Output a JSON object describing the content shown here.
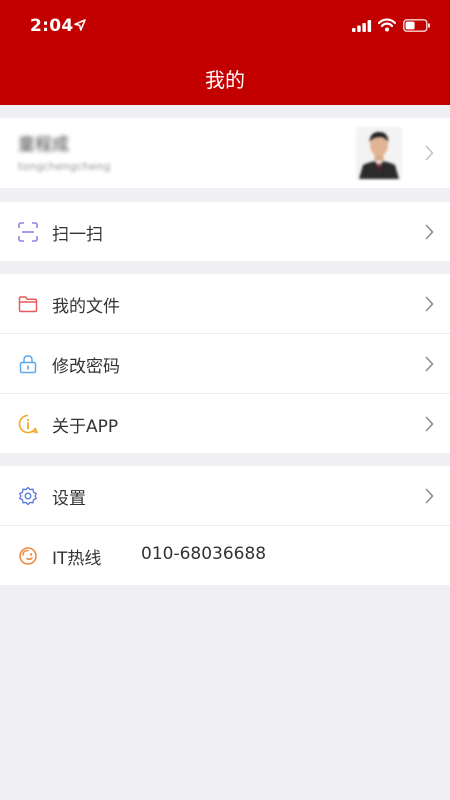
{
  "status_bar": {
    "time": "2:04"
  },
  "header": {
    "title": "我的"
  },
  "profile": {
    "name": "童程成",
    "username": "tongchengcheng"
  },
  "menu": {
    "scan": {
      "label": "扫一扫"
    },
    "my_files": {
      "label": "我的文件"
    },
    "change_password": {
      "label": "修改密码"
    },
    "about": {
      "label": "关于APP"
    },
    "settings": {
      "label": "设置"
    },
    "it_hotline": {
      "label": "IT热线",
      "value": "010-68036688"
    }
  },
  "colors": {
    "header_red": "#c30000",
    "background": "#efeff4",
    "scan_icon": "#8a86e8",
    "files_icon": "#ee5a5a",
    "password_icon": "#5aa7ec",
    "about_icon": "#f5a623",
    "settings_icon": "#5b7fd8",
    "hotline_icon": "#f08a40"
  },
  "icons": [
    "location-arrow-icon",
    "signal-icon",
    "wifi-icon",
    "battery-icon",
    "scan-icon",
    "folder-icon",
    "lock-icon",
    "info-icon",
    "gear-icon",
    "headset-icon",
    "chevron-right-icon"
  ]
}
